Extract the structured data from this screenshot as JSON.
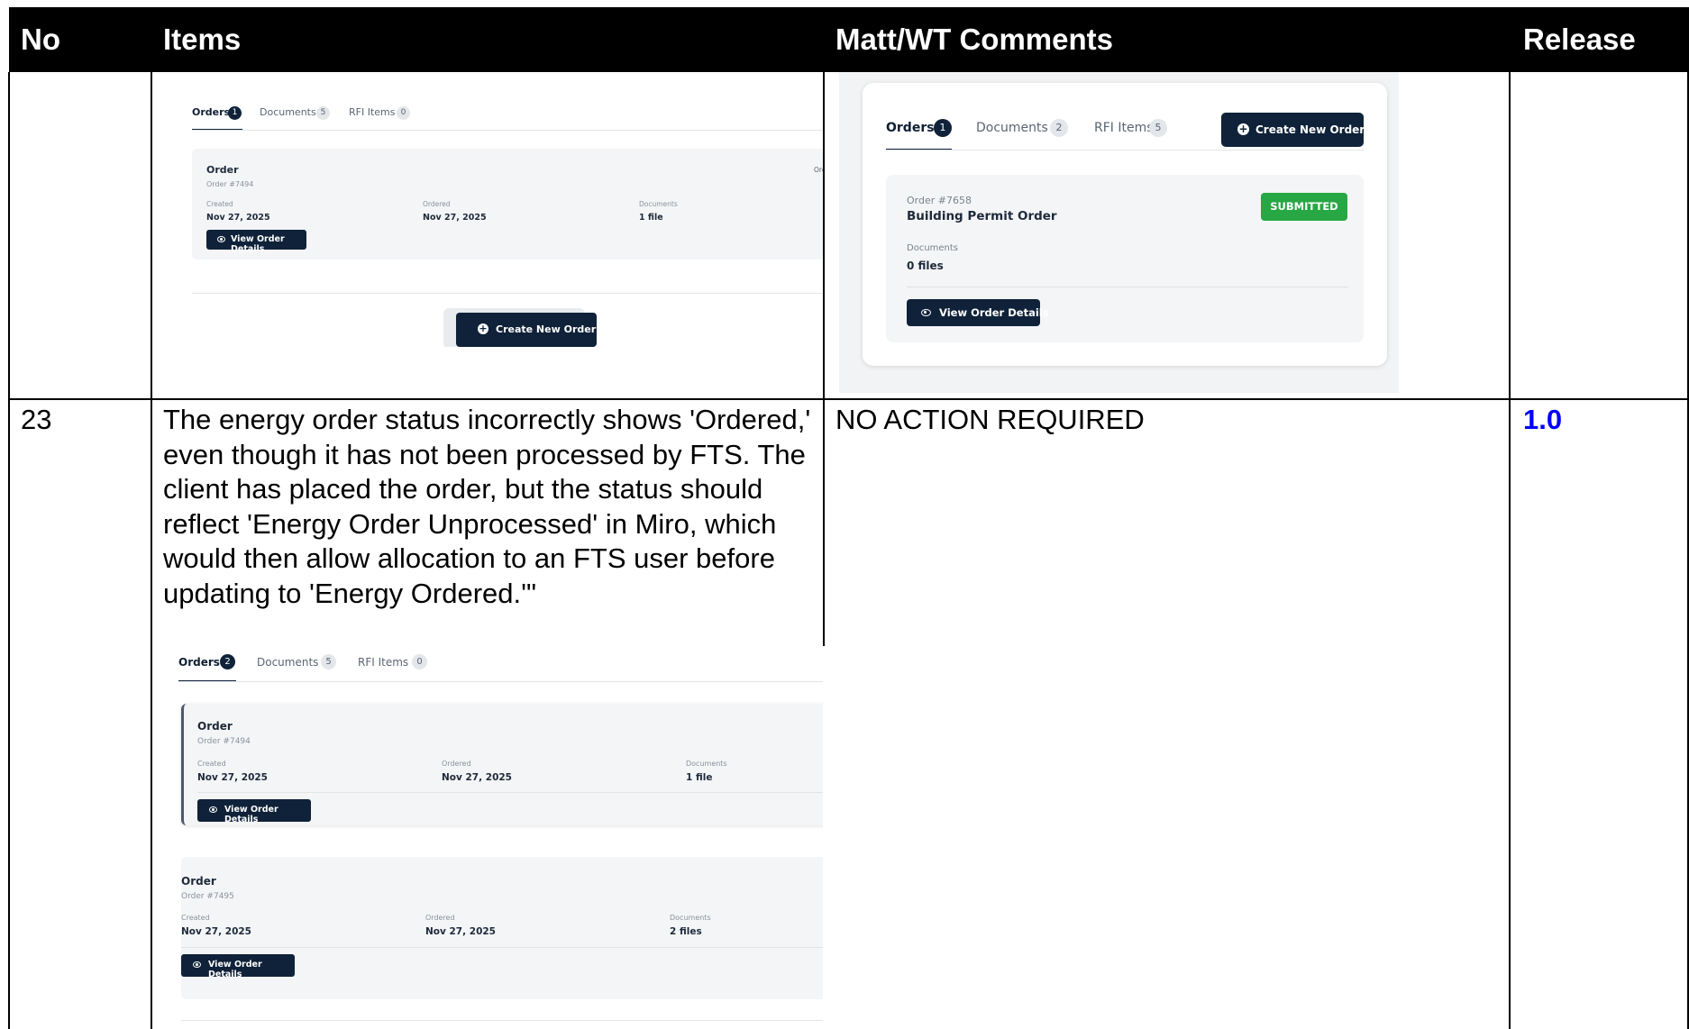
{
  "table": {
    "headers": {
      "no": "No",
      "items": "Items",
      "comments": "Matt/WT Comments",
      "release": "Release"
    }
  },
  "row23": {
    "no": "23",
    "item_text": "The energy order status incorrectly shows 'Ordered,' even though it has not been processed by FTS. The client has placed the order, but the status should reflect 'Energy Order Unprocessed' in Miro, which would then allow allocation to an FTS user before updating to 'Energy Ordered.'\"",
    "comment": "NO ACTION REQUIRED",
    "release": "1.0",
    "release_color": "#0000ff"
  },
  "shot_top_left": {
    "tabs": {
      "orders": "Orders",
      "orders_count": "1",
      "documents": "Documents",
      "documents_count": "5",
      "rfi": "RFI Items",
      "rfi_count": "0"
    },
    "order": {
      "title": "Order",
      "number": "Order #7494",
      "right_cut": "Orc",
      "created_label": "Created",
      "created_value": "Nov 27, 2025",
      "ordered_label": "Ordered",
      "ordered_value": "Nov 27, 2025",
      "documents_label": "Documents",
      "documents_value": "1 file",
      "view_button": "View Order Details"
    },
    "create_button": "Create New Order"
  },
  "shot_top_right": {
    "tabs": {
      "orders": "Orders",
      "orders_count": "1",
      "documents": "Documents",
      "documents_count": "2",
      "rfi": "RFI Items",
      "rfi_count": "5"
    },
    "create_button": "Create New Order",
    "order": {
      "number": "Order #7658",
      "title": "Building Permit Order",
      "status": "SUBMITTED",
      "documents_label": "Documents",
      "documents_value": "0 files",
      "view_button": "View Order Details"
    },
    "colors": {
      "status_green": "#28a745",
      "navy": "#0f2239"
    }
  },
  "shot_row23": {
    "tabs": {
      "orders": "Orders",
      "orders_count": "2",
      "documents": "Documents",
      "documents_count": "5",
      "rfi": "RFI Items",
      "rfi_count": "0"
    },
    "orders": [
      {
        "title": "Order",
        "number": "Order #7494",
        "created_label": "Created",
        "created_value": "Nov 27, 2025",
        "ordered_label": "Ordered",
        "ordered_value": "Nov 27, 2025",
        "documents_label": "Documents",
        "documents_value": "1 file",
        "view_button": "View Order Details"
      },
      {
        "title": "Order",
        "number": "Order #7495",
        "created_label": "Created",
        "created_value": "Nov 27, 2025",
        "ordered_label": "Ordered",
        "ordered_value": "Nov 27, 2025",
        "documents_label": "Documents",
        "documents_value": "2 files",
        "view_button": "View Order Details"
      }
    ]
  }
}
